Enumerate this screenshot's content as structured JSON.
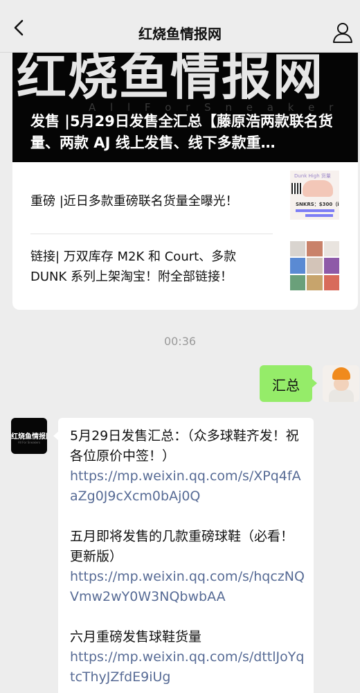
{
  "header": {
    "title": "红烧鱼情报网"
  },
  "article_card": {
    "banner_big_text": "红烧鱼情报网",
    "banner_title": "发售 |5月29日发售全汇总【藤原浩两款联名货量、两款 AJ 线上发售、线下多款重…",
    "items": [
      {
        "text": "重磅 |近日多款重磅联名货量全曝光！"
      },
      {
        "text": "链接| 万双库存 M2K 和 Court、多款 DUNK 系列上架淘宝！附全部链接！"
      }
    ],
    "thumb1_labels": {
      "top": "Dunk High 货量",
      "price": "SNKRS：$300（ios）"
    }
  },
  "timestamp": "00:36",
  "outgoing_message": {
    "text": "汇总"
  },
  "incoming_message": {
    "avatar_text": "红烧鱼情报网",
    "blocks": [
      {
        "text": "5月29日发售汇总：（众多球鞋齐发！祝各位原价中签！）",
        "link": "https://mp.weixin.qq.com/s/XPq4fAaZg0J9cXcm0bAj0Q"
      },
      {
        "text": "五月即将发售的几款重磅球鞋（必看！更新版）",
        "link": "https://mp.weixin.qq.com/s/hqczNQVmw2wY0W3NQbwbAA"
      },
      {
        "text": "六月重磅发售球鞋货量",
        "link": "https://mp.weixin.qq.com/s/dttlJoYqtcThyJZfdE9iUg"
      }
    ]
  },
  "colors": {
    "background": "#ededed",
    "outgoing_bubble": "#95ec69",
    "link": "#576b95"
  }
}
